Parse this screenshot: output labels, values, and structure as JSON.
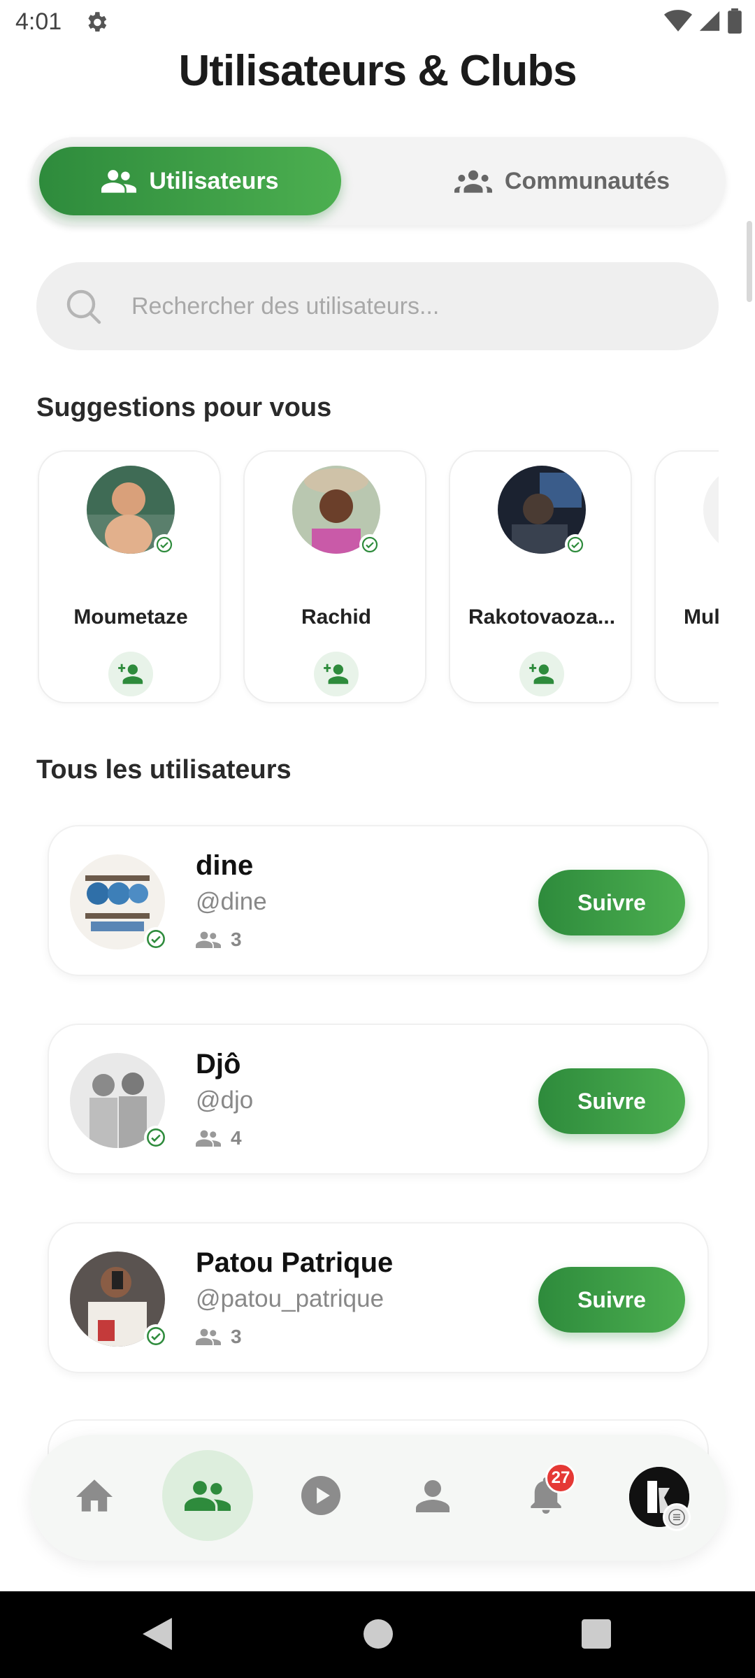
{
  "status_bar": {
    "time": "4:01"
  },
  "header": {
    "title": "Utilisateurs & Clubs"
  },
  "tabs": [
    {
      "label": "Utilisateurs",
      "active": true,
      "icon": "people-icon"
    },
    {
      "label": "Communautés",
      "active": false,
      "icon": "groups-icon"
    }
  ],
  "search": {
    "placeholder": "Rechercher des utilisateurs...",
    "value": ""
  },
  "suggestions": {
    "heading": "Suggestions pour vous",
    "items": [
      {
        "name": "Moumetaze"
      },
      {
        "name": "Rachid"
      },
      {
        "name": "Rakotovaoza..."
      },
      {
        "name": "Mul"
      }
    ]
  },
  "all_users": {
    "heading": "Tous les utilisateurs",
    "items": [
      {
        "name": "dine",
        "handle": "@dine",
        "followers": "3",
        "action": "Suivre"
      },
      {
        "name": "Djô",
        "handle": "@djo",
        "followers": "4",
        "action": "Suivre"
      },
      {
        "name": "Patou Patrique",
        "handle": "@patou_patrique",
        "followers": "3",
        "action": "Suivre"
      }
    ]
  },
  "bottom_nav": {
    "items": [
      "home-icon",
      "people-icon",
      "play-icon",
      "person-icon",
      "bell-icon",
      "profile-avatar"
    ],
    "active": "people-icon",
    "notification_count": "27"
  },
  "colors": {
    "accent": "#2e8b3c",
    "accent_light": "#4caf50",
    "badge": "#e53935"
  }
}
